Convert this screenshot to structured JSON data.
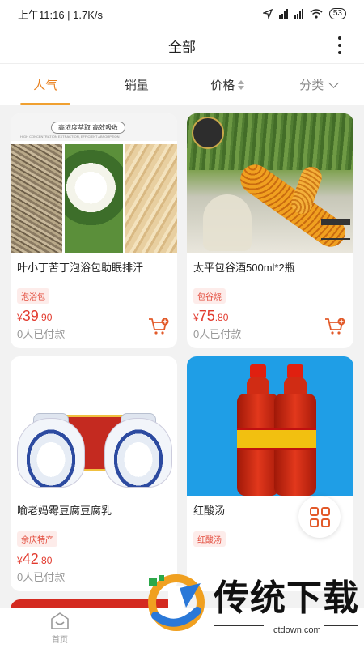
{
  "status_bar": {
    "time_speed": "上午11:16 | 1.7K/s",
    "battery": "53"
  },
  "header": {
    "title": "全部"
  },
  "tabs": [
    {
      "label": "人气",
      "active": true
    },
    {
      "label": "销量",
      "active": false
    },
    {
      "label": "价格",
      "active": false
    },
    {
      "label": "分类",
      "active": false
    }
  ],
  "products": [
    {
      "name": "叶小丁苦丁泡浴包助眠排汗",
      "tag": "泡浴包",
      "price_currency": "¥",
      "price_int": "39",
      "price_dec": ".90",
      "sold": "0人已付款",
      "image_text": {
        "badge": "高浓度萃取 高效吸收",
        "sub": "HIGH CONCENTRATION EXTRACTION, EFFICIENT ABSORPTION"
      }
    },
    {
      "name": "太平包谷酒500ml*2瓶",
      "tag": "包谷烧",
      "price_currency": "¥",
      "price_int": "75",
      "price_dec": ".80",
      "sold": "0人已付款"
    },
    {
      "name": "喻老妈霉豆腐豆腐乳",
      "tag": "余庆特产",
      "price_currency": "¥",
      "price_int": "42",
      "price_dec": ".80",
      "sold": "0人已付款"
    },
    {
      "name": "红酸汤",
      "tag": "红酸汤"
    }
  ],
  "bottom_nav": {
    "home_label": "首页"
  },
  "watermark": {
    "text": "传统下载",
    "url": "ctdown.com"
  },
  "colors": {
    "accent": "#e8801e",
    "price": "#e23a2e",
    "tag_bg": "#fdecea"
  }
}
